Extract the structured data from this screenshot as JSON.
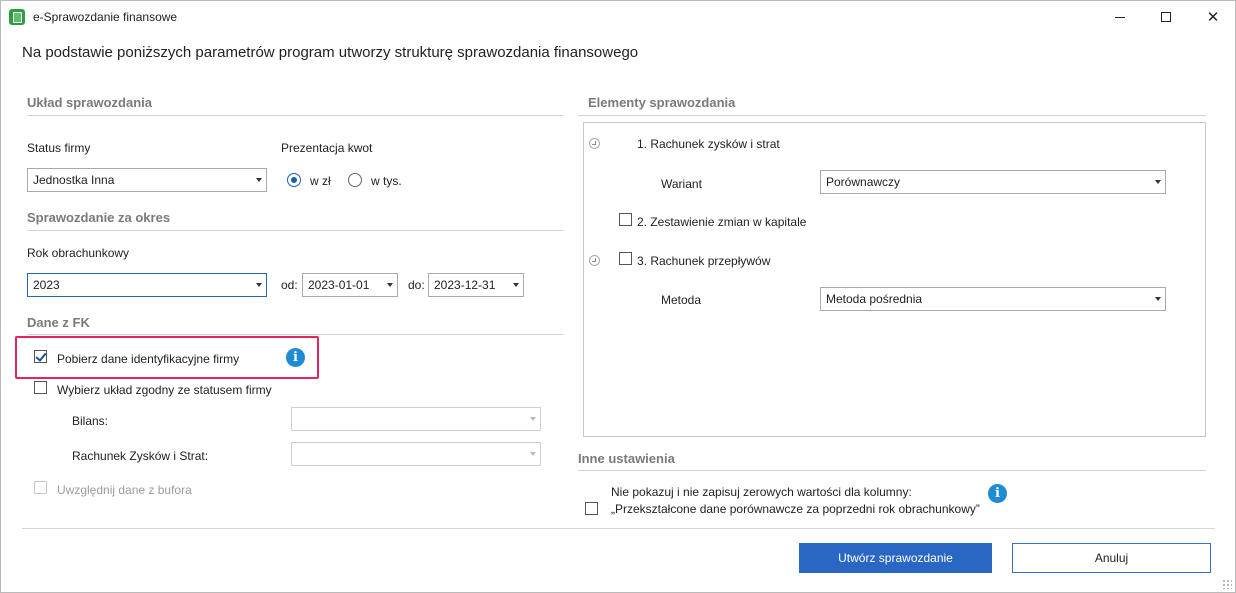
{
  "window": {
    "title": "e-Sprawozdanie finansowe"
  },
  "header": {
    "text": "Na podstawie poniższych parametrów program utworzy strukturę sprawozdania finansowego"
  },
  "uklad": {
    "title": "Układ sprawozdania",
    "status_label": "Status firmy",
    "status_value": "Jednostka Inna",
    "prezentacja_label": "Prezentacja kwot",
    "radio_zl": "w zł",
    "radio_tys": "w tys.",
    "selected": "w zł"
  },
  "okres": {
    "title": "Sprawozdanie za okres",
    "rok_label": "Rok obrachunkowy",
    "rok_value": "2023",
    "od_label": "od:",
    "od_value": "2023-01-01",
    "do_label": "do:",
    "do_value": "2023-12-31"
  },
  "fk": {
    "title": "Dane z FK",
    "pobierz_label": "Pobierz dane identyfikacyjne firmy",
    "pobierz_checked": true,
    "wybierz_label": "Wybierz układ zgodny ze statusem firmy",
    "wybierz_checked": false,
    "bilans_label": "Bilans:",
    "bilans_value": "",
    "rzis_label": "Rachunek Zysków i Strat:",
    "rzis_value": "",
    "bufor_label": "Uwzględnij dane z bufora",
    "bufor_checked": false
  },
  "elementy": {
    "title": "Elementy sprawozdania",
    "item1_label": "1. Rachunek zysków i strat",
    "wariant_label": "Wariant",
    "wariant_value": "Porównawczy",
    "item2_label": "2. Zestawienie zmian w kapitale",
    "item3_label": "3. Rachunek przepływów",
    "metoda_label": "Metoda",
    "metoda_value": "Metoda pośrednia"
  },
  "inne": {
    "title": "Inne ustawienia",
    "zero_line1": "Nie pokazuj i nie zapisuj zerowych wartości dla kolumny:",
    "zero_line2": "„Przekształcone dane porównawcze za poprzedni rok obrachunkowy”"
  },
  "buttons": {
    "create": "Utwórz sprawozdanie",
    "cancel": "Anuluj"
  },
  "icons": {
    "info": "i"
  },
  "colors": {
    "accent": "#2a66c4",
    "highlight": "#e4245a",
    "info": "#1f8bd3"
  }
}
